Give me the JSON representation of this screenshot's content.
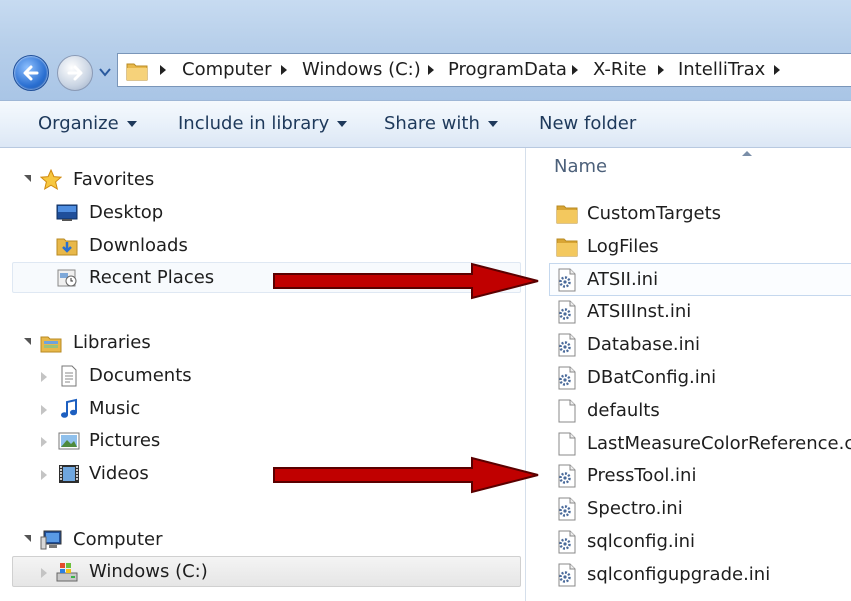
{
  "breadcrumbs": [
    "Computer",
    "Windows (C:)",
    "ProgramData",
    "X-Rite",
    "IntelliTrax"
  ],
  "toolbar": {
    "organize": "Organize",
    "include_in_library": "Include in library",
    "share_with": "Share with",
    "new_folder": "New folder"
  },
  "nav": {
    "favorites": "Favorites",
    "desktop": "Desktop",
    "downloads": "Downloads",
    "recent_places": "Recent Places",
    "libraries": "Libraries",
    "documents": "Documents",
    "music": "Music",
    "pictures": "Pictures",
    "videos": "Videos",
    "computer": "Computer",
    "windows_c": "Windows (C:)"
  },
  "filelist": {
    "column_name": "Name",
    "items": [
      {
        "name": "CustomTargets",
        "icon": "folder-icon"
      },
      {
        "name": "LogFiles",
        "icon": "folder-icon"
      },
      {
        "name": "ATSII.ini",
        "icon": "config-file-icon"
      },
      {
        "name": "ATSIIInst.ini",
        "icon": "config-file-icon"
      },
      {
        "name": "Database.ini",
        "icon": "config-file-icon"
      },
      {
        "name": "DBatConfig.ini",
        "icon": "config-file-icon"
      },
      {
        "name": "defaults",
        "icon": "blank-file-icon"
      },
      {
        "name": "LastMeasureColorReference.ccv",
        "icon": "blank-file-icon"
      },
      {
        "name": "PressTool.ini",
        "icon": "config-file-icon"
      },
      {
        "name": "Spectro.ini",
        "icon": "config-file-icon"
      },
      {
        "name": "sqlconfig.ini",
        "icon": "config-file-icon"
      },
      {
        "name": "sqlconfigupgrade.ini",
        "icon": "config-file-icon"
      }
    ]
  },
  "colors": {
    "arrow": "#c00000",
    "toolbar_text": "#1e395b",
    "folder": "#e8b84a"
  }
}
